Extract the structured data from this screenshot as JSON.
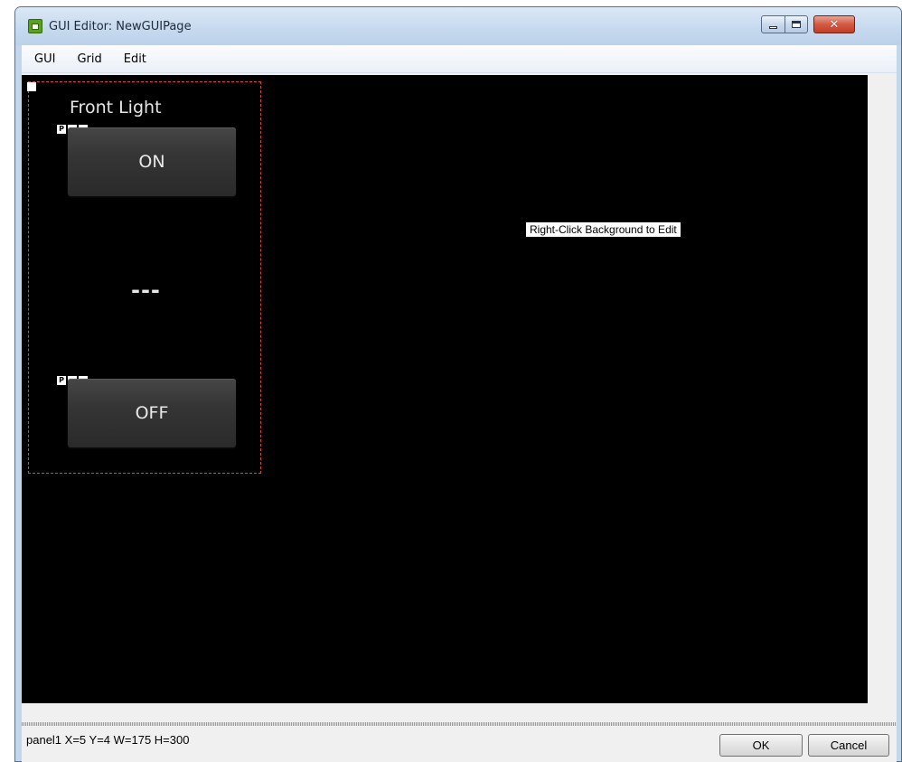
{
  "window": {
    "title": "GUI Editor: NewGUIPage",
    "icon": "app-window-icon"
  },
  "menu": {
    "items": [
      {
        "label": "GUI"
      },
      {
        "label": "Grid"
      },
      {
        "label": "Edit"
      }
    ]
  },
  "canvas": {
    "hint": "Right-Click Background to Edit",
    "panel": {
      "title": "Front Light",
      "on_button": {
        "label": "ON",
        "handle_label": "P"
      },
      "separator": "---",
      "off_button": {
        "label": "OFF",
        "handle_label": "P"
      }
    }
  },
  "footer": {
    "status": "panel1 X=5 Y=4 W=175 H=300",
    "ok_label": "OK",
    "cancel_label": "Cancel"
  },
  "colors": {
    "canvas_background": "#000000",
    "selection_outline": "#e0403f",
    "button_face": "#353535",
    "close_button": "#c23d26"
  }
}
